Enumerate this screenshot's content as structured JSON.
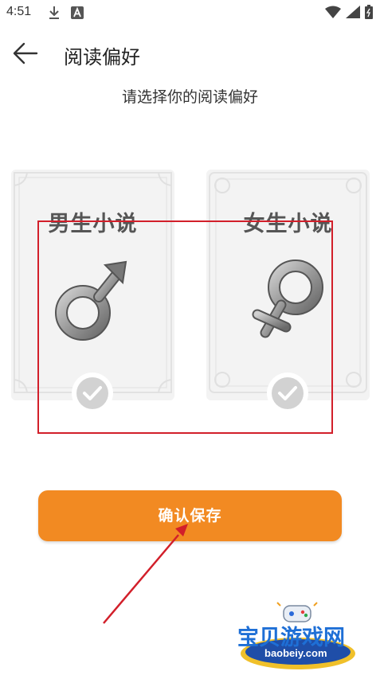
{
  "status_bar": {
    "time": "4:51",
    "icons": [
      "download-icon",
      "a-badge-icon",
      "wifi-icon",
      "signal-icon",
      "battery-icon"
    ]
  },
  "header": {
    "back_icon": "arrow-left-icon",
    "title": "阅读偏好"
  },
  "subtitle": "请选择你的阅读偏好",
  "options": [
    {
      "label": "男生小说",
      "icon": "male-symbol-icon",
      "checked": false
    },
    {
      "label": "女生小说",
      "icon": "female-symbol-icon",
      "checked": false
    }
  ],
  "confirm_label": "确认保存",
  "watermark": {
    "text": "宝贝游戏网",
    "url": "baobeiy.com"
  },
  "colors": {
    "accent": "#f28a22",
    "annotation": "#d21f2a",
    "watermark_blue": "#1e6fd6"
  }
}
